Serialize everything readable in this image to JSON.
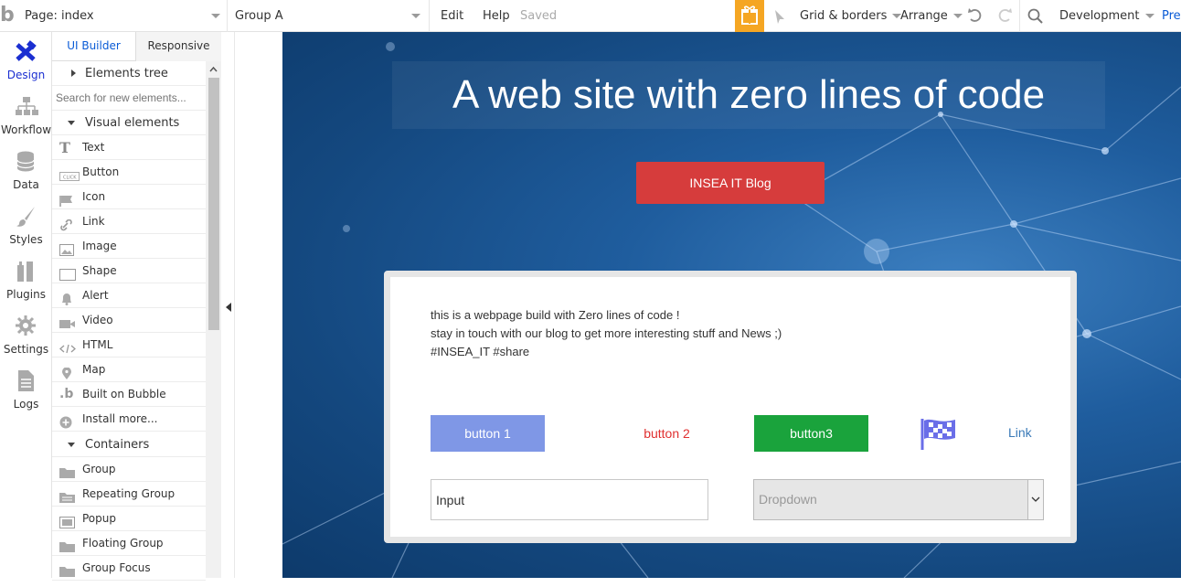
{
  "topbar": {
    "logo": "b",
    "page_label": "Page: index",
    "element_label": "Group A",
    "edit": "Edit",
    "help": "Help",
    "saved": "Saved",
    "grid_borders": "Grid & borders",
    "arrange": "Arrange",
    "environment": "Development",
    "preview": "Prev"
  },
  "leftnav": {
    "items": [
      {
        "label": "Design",
        "icon": "design-icon"
      },
      {
        "label": "Workflow",
        "icon": "workflow-icon"
      },
      {
        "label": "Data",
        "icon": "database-icon"
      },
      {
        "label": "Styles",
        "icon": "brush-icon"
      },
      {
        "label": "Plugins",
        "icon": "plugin-icon"
      },
      {
        "label": "Settings",
        "icon": "gear-icon"
      },
      {
        "label": "Logs",
        "icon": "document-icon"
      }
    ]
  },
  "panel": {
    "tab_ui_builder": "UI Builder",
    "tab_responsive": "Responsive",
    "elements_tree": "Elements tree",
    "search_placeholder": "Search for new elements...",
    "visual_elements": "Visual elements",
    "visual_items": [
      {
        "label": "Text",
        "icon": "text-icon"
      },
      {
        "label": "Button",
        "icon": "button-icon"
      },
      {
        "label": "Icon",
        "icon": "flag-icon"
      },
      {
        "label": "Link",
        "icon": "link-icon"
      },
      {
        "label": "Image",
        "icon": "image-icon"
      },
      {
        "label": "Shape",
        "icon": "shape-icon"
      },
      {
        "label": "Alert",
        "icon": "bell-icon"
      },
      {
        "label": "Video",
        "icon": "video-icon"
      },
      {
        "label": "HTML",
        "icon": "code-icon"
      },
      {
        "label": "Map",
        "icon": "map-pin-icon"
      },
      {
        "label": "Built on Bubble",
        "icon": "bubble-logo-icon"
      },
      {
        "label": "Install more...",
        "icon": "plus-icon"
      }
    ],
    "containers": "Containers",
    "container_items": [
      {
        "label": "Group",
        "icon": "folder-icon"
      },
      {
        "label": "Repeating Group",
        "icon": "folder-icon"
      },
      {
        "label": "Popup",
        "icon": "popup-icon"
      },
      {
        "label": "Floating Group",
        "icon": "folder-icon"
      },
      {
        "label": "Group Focus",
        "icon": "folder-icon"
      }
    ]
  },
  "canvas": {
    "title": "A web site with zero lines of code",
    "blog_button": "INSEA IT Blog",
    "card": {
      "line1": "this is a webpage build with Zero lines of code !",
      "line2": "stay in touch with our blog to get more interesting stuff and News ;)",
      "line3": "#INSEA_IT #share",
      "button1": "button 1",
      "button2": "button 2",
      "button3": "button3",
      "link": "Link",
      "input_value": "Input",
      "dropdown_value": "Dropdown"
    }
  },
  "colors": {
    "accent": "#0a5bd6",
    "gift": "#f5a623",
    "blog_button": "#d63c3c",
    "button1": "#7f97e6",
    "button3": "#1aa33c",
    "button2_text": "#e03030"
  }
}
